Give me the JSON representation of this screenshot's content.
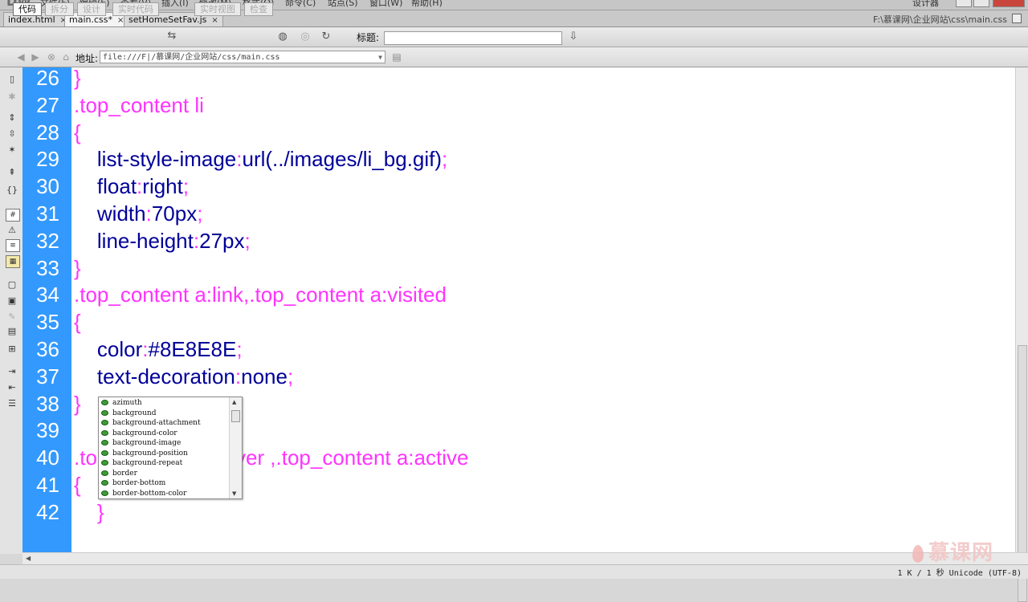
{
  "menu": {
    "logo": "DW",
    "items": [
      "文件(F)",
      "编辑(E)",
      "查看(V)",
      "插入(I)",
      "修改(M)",
      "格式(O)",
      "命令(C)",
      "站点(S)",
      "窗口(W)",
      "帮助(H)"
    ],
    "workspace": "设计器"
  },
  "tabs": [
    {
      "label": "index.html",
      "close": "×"
    },
    {
      "label": "main.css*",
      "close": "×"
    },
    {
      "label": "setHomeSetFav.js",
      "close": "×"
    }
  ],
  "filepath": "F:\\慕课网\\企业网站\\css\\main.css",
  "doc_toolbar": {
    "code": "代码",
    "split": "拆分",
    "design": "设计",
    "live_code": "实时代码",
    "live_view": "实时视图",
    "inspect": "检查",
    "title_label": "标题:",
    "title_value": ""
  },
  "address": {
    "label": "地址:",
    "value": "file:///F|/慕课网/企业网站/css/main.css"
  },
  "code_lines": [
    {
      "n": "26",
      "parts": [
        {
          "t": "}",
          "c": "pun"
        }
      ]
    },
    {
      "n": "27",
      "parts": [
        {
          "t": ".top_content li",
          "c": "sel"
        }
      ]
    },
    {
      "n": "28",
      "parts": [
        {
          "t": "{",
          "c": "pun"
        }
      ]
    },
    {
      "n": "29",
      "parts": [
        {
          "t": "    list-style-image",
          "c": "prop"
        },
        {
          "t": ":",
          "c": "pun"
        },
        {
          "t": "url(../images/li_bg.gif)",
          "c": "prop"
        },
        {
          "t": ";",
          "c": "pun"
        }
      ]
    },
    {
      "n": "30",
      "parts": [
        {
          "t": "    float",
          "c": "prop"
        },
        {
          "t": ":",
          "c": "pun"
        },
        {
          "t": "right",
          "c": "prop"
        },
        {
          "t": ";",
          "c": "pun"
        }
      ]
    },
    {
      "n": "31",
      "parts": [
        {
          "t": "    width",
          "c": "prop"
        },
        {
          "t": ":",
          "c": "pun"
        },
        {
          "t": "70px",
          "c": "prop"
        },
        {
          "t": ";",
          "c": "pun"
        }
      ]
    },
    {
      "n": "32",
      "parts": [
        {
          "t": "    line-height",
          "c": "prop"
        },
        {
          "t": ":",
          "c": "pun"
        },
        {
          "t": "27px",
          "c": "prop"
        },
        {
          "t": ";",
          "c": "pun"
        }
      ]
    },
    {
      "n": "33",
      "parts": [
        {
          "t": "}",
          "c": "pun"
        }
      ]
    },
    {
      "n": "34",
      "parts": [
        {
          "t": ".top_content a:link,.top_content a:visited",
          "c": "sel"
        }
      ]
    },
    {
      "n": "35",
      "parts": [
        {
          "t": "{",
          "c": "pun"
        }
      ]
    },
    {
      "n": "36",
      "parts": [
        {
          "t": "    color",
          "c": "prop"
        },
        {
          "t": ":",
          "c": "pun"
        },
        {
          "t": "#8E8E8E",
          "c": "prop"
        },
        {
          "t": ";",
          "c": "pun"
        }
      ]
    },
    {
      "n": "37",
      "parts": [
        {
          "t": "    text-decoration",
          "c": "prop"
        },
        {
          "t": ":",
          "c": "pun"
        },
        {
          "t": "none",
          "c": "prop"
        },
        {
          "t": ";",
          "c": "pun"
        }
      ]
    },
    {
      "n": "38",
      "parts": [
        {
          "t": "}",
          "c": "pun"
        }
      ]
    },
    {
      "n": "39",
      "parts": []
    },
    {
      "n": "40",
      "parts": [
        {
          "t": ".top_content a:hover ,.top_content a:active",
          "c": "sel"
        }
      ]
    },
    {
      "n": "41",
      "parts": [
        {
          "t": "{",
          "c": "pun"
        }
      ]
    },
    {
      "n": "42",
      "parts": [
        {
          "t": "    }",
          "c": "pun"
        }
      ]
    }
  ],
  "code_hint": {
    "items": [
      "azimuth",
      "background",
      "background-attachment",
      "background-color",
      "background-image",
      "background-position",
      "background-repeat",
      "border",
      "border-bottom",
      "border-bottom-color"
    ]
  },
  "status": "1 K / 1 秒 Unicode (UTF-8)",
  "watermark": "慕课网",
  "colors": {
    "gutter": "#3399ff",
    "selector": "#ff33ff",
    "property": "#000099"
  }
}
